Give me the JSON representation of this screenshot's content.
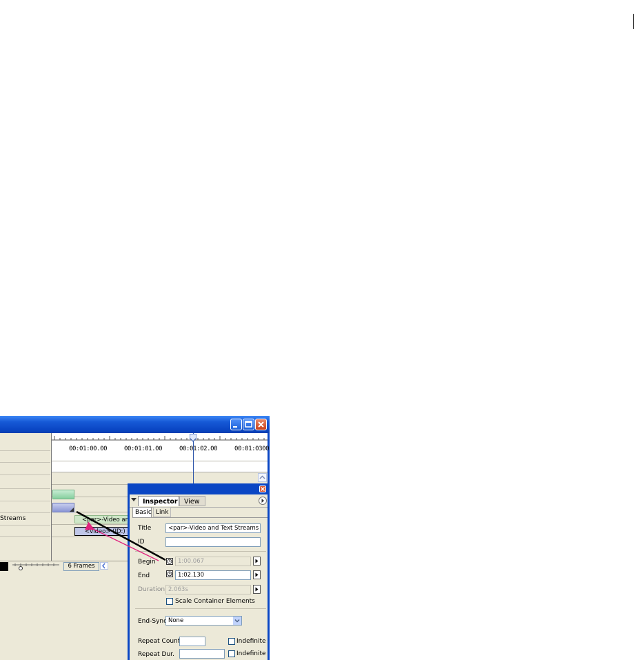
{
  "colors": {
    "title_bar": "#0a46c4",
    "window_bg": "#ece9d8",
    "annotation_arrow": "#e0237e",
    "playhead": "#2d55aa"
  },
  "timeline": {
    "window_buttons": [
      "minimize-icon",
      "maximize-icon",
      "close-icon"
    ],
    "layer_label": "Streams",
    "ruler_labels": [
      "00:01:00.00",
      "00:01:01.00",
      "00:01:02.00",
      "00:01:0300"
    ],
    "clips": {
      "par_label": "<par>-Video and",
      "video_label": "<video> (ID:)"
    },
    "frames": "6 Frames"
  },
  "inspector": {
    "tabs": [
      "Inspector",
      "View"
    ],
    "subtabs": [
      "Basic",
      "Link"
    ],
    "fields": {
      "title_label": "Title",
      "title_value": "<par>-Video and Text Streams",
      "id_label": "ID",
      "id_value": "",
      "begin_label": "Begin",
      "begin_value": "1:00.067",
      "end_label": "End",
      "end_value": "1:02.130",
      "duration_label": "Duration",
      "duration_value": "2.063s",
      "scale_label": "Scale Container Elements",
      "endsync_label": "End-Sync",
      "endsync_value": "None",
      "repeat_count_label": "Repeat Count",
      "repeat_count_value": "",
      "repeat_dur_label": "Repeat Dur.",
      "repeat_dur_value": "",
      "indefinite_label": "Indefinite"
    }
  }
}
